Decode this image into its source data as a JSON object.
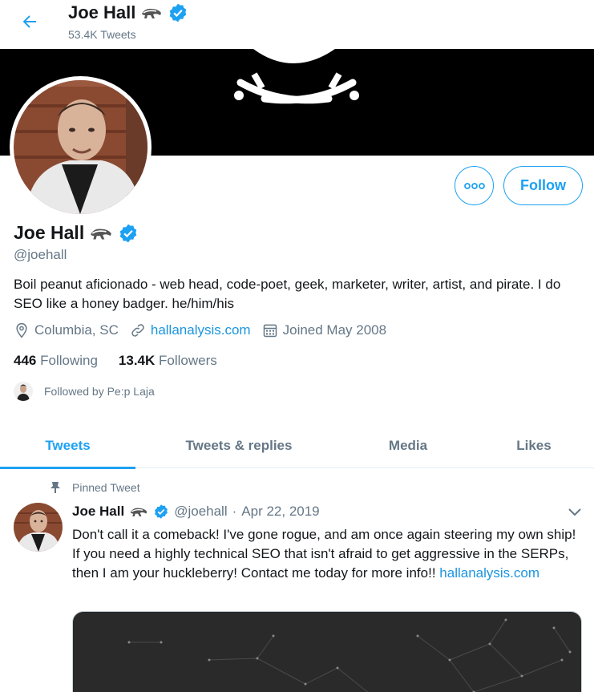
{
  "header": {
    "name": "Joe Hall",
    "tweet_count": "53.4K Tweets"
  },
  "profile": {
    "name": "Joe Hall",
    "handle": "@joehall",
    "bio": "Boil peanut aficionado - web head, code-poet, geek, marketer, writer, artist, and pirate. I do SEO like a honey badger. he/him/his",
    "location": "Columbia, SC",
    "website": "hallanalysis.com",
    "joined": "Joined May 2008",
    "following_count": "446",
    "following_label": "Following",
    "followers_count": "13.4K",
    "followers_label": "Followers",
    "followed_by": "Followed by Pe:p Laja",
    "follow_label": "Follow"
  },
  "tabs": [
    {
      "label": "Tweets",
      "active": true
    },
    {
      "label": "Tweets & replies",
      "active": false
    },
    {
      "label": "Media",
      "active": false
    },
    {
      "label": "Likes",
      "active": false
    }
  ],
  "pinned_tweet": {
    "pinned_label": "Pinned Tweet",
    "name": "Joe Hall",
    "handle": "@joehall",
    "separator": "·",
    "date": "Apr 22, 2019",
    "text": "Don't call it a comeback! I've gone rogue, and am once again steering my own ship! If you need a highly technical SEO that isn't afraid to get aggressive in the SERPs, then I am your huckleberry! Contact me today for more info!!",
    "link": "hallanalysis.com"
  },
  "colors": {
    "accent": "#1da1f2",
    "link": "#1b95e0",
    "muted": "#657786",
    "text": "#14171a",
    "banner": "#000000"
  },
  "icons": {
    "back": "arrow-left-icon",
    "verified": "verified-badge-icon",
    "badger": "badger-emoji-icon",
    "location": "location-pin-icon",
    "link": "link-icon",
    "calendar": "calendar-icon",
    "more": "more-dots-icon",
    "pin": "pin-icon",
    "caret": "chevron-down-icon"
  }
}
